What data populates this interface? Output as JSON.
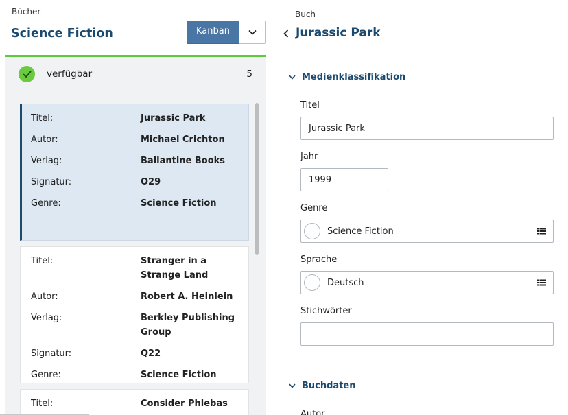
{
  "left": {
    "eyebrow": "Bücher",
    "title": "Science Fiction",
    "view_button": "Kanban"
  },
  "lane": {
    "label": "verfügbar",
    "count": "5"
  },
  "cards": [
    {
      "fields": [
        {
          "k": "Titel:",
          "v": "Jurassic Park"
        },
        {
          "k": "Autor:",
          "v": "Michael Crichton"
        },
        {
          "k": "Verlag:",
          "v": "Ballantine Books"
        },
        {
          "k": "Signatur:",
          "v": "O29"
        },
        {
          "k": "Genre:",
          "v": "Science Fiction"
        }
      ]
    },
    {
      "fields": [
        {
          "k": "Titel:",
          "v1": "Stranger in a",
          "v2": "Strange Land"
        },
        {
          "k": "Autor:",
          "v": "Robert A. Heinlein"
        },
        {
          "k": "Verlag:",
          "v1": "Berkley Publishing",
          "v2": "Group"
        },
        {
          "k": "Signatur:",
          "v": "Q22"
        },
        {
          "k": "Genre:",
          "v": "Science Fiction"
        }
      ]
    },
    {
      "fields": [
        {
          "k": "Titel:",
          "v": "Consider Phlebas"
        }
      ]
    }
  ],
  "right": {
    "eyebrow": "Buch",
    "title": "Jurassic Park",
    "section1": "Medienklassifikation",
    "section2": "Buchdaten",
    "fields": {
      "titel_label": "Titel",
      "titel_value": "Jurassic Park",
      "jahr_label": "Jahr",
      "jahr_value": "1999",
      "genre_label": "Genre",
      "genre_value": "Science Fiction",
      "sprache_label": "Sprache",
      "sprache_value": "Deutsch",
      "stichwoerter_label": "Stichwörter",
      "stichwoerter_value": "",
      "autor_label": "Autor"
    }
  },
  "colors": {
    "accent": "#1b4a70",
    "button": "#4a76a6",
    "status_green": "#6acb3e",
    "selected_card": "#dde8f2"
  },
  "icons": [
    "chevron-down-icon",
    "check-icon",
    "chevron-left-icon",
    "list-icon"
  ]
}
